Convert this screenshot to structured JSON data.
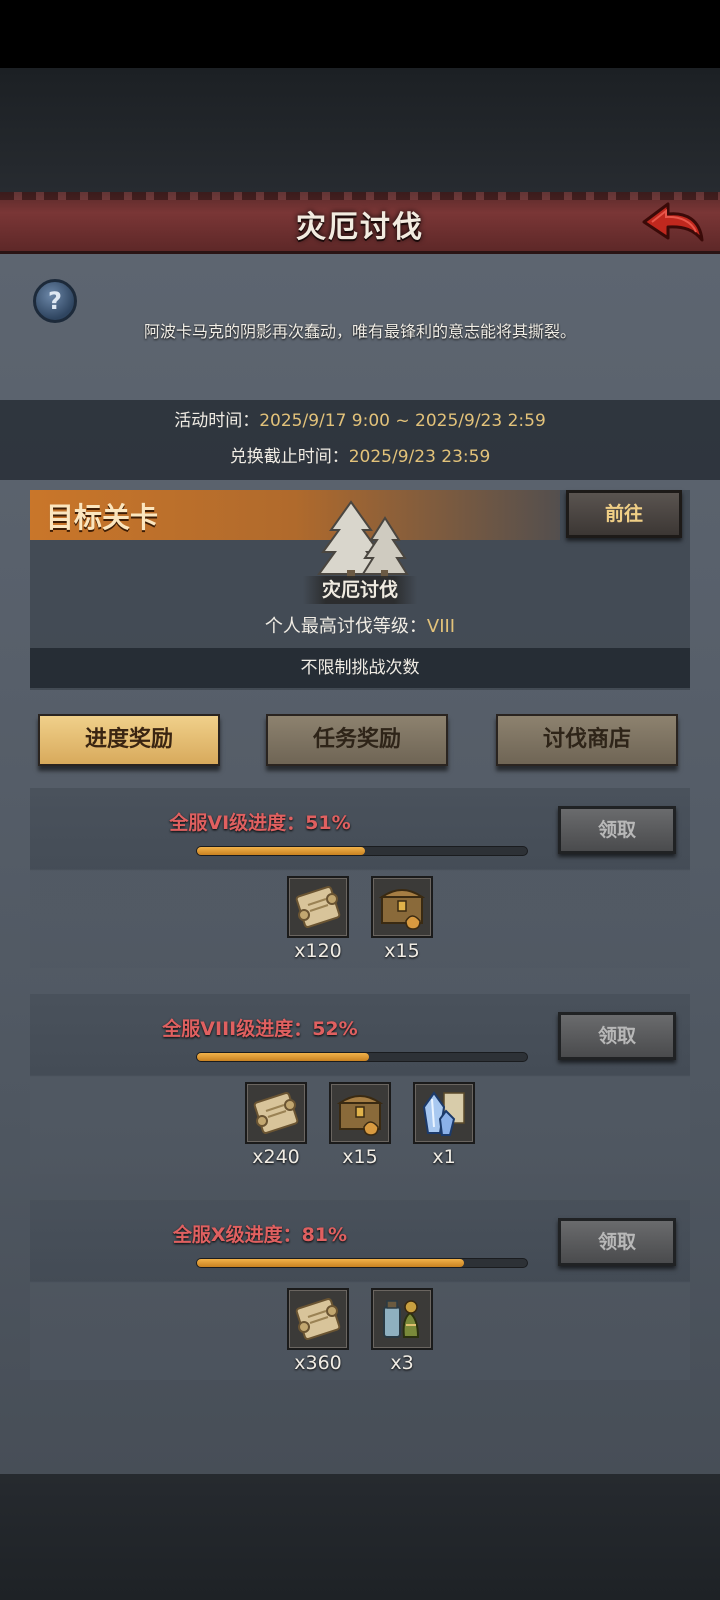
{
  "header": {
    "title": "灾厄讨伐"
  },
  "description": "阿波卡马克的阴影再次蠢动，唯有最锋利的意志能将其撕裂。",
  "event_time": {
    "label": "活动时间：",
    "value": "2025/9/17 9:00 ~ 2025/9/23 2:59"
  },
  "exchange_deadline": {
    "label": "兑换截止时间：",
    "value": "2025/9/23 23:59"
  },
  "target": {
    "title": "目标关卡",
    "goto_label": "前往",
    "stage_name": "灾厄讨伐",
    "best_level_label": "个人最高讨伐等级：",
    "best_level_value": "VIII",
    "unlimited_text": "不限制挑战次数"
  },
  "tabs": [
    {
      "label": "进度奖励",
      "active": true
    },
    {
      "label": "任务奖励",
      "active": false
    },
    {
      "label": "讨伐商店",
      "active": false
    }
  ],
  "rewards": [
    {
      "label": "全服VI级进度：51%",
      "progress": 0.51,
      "claim_label": "领取",
      "items": [
        {
          "icon": "scroll-icon",
          "qty": "x120"
        },
        {
          "icon": "treasure-chest-icon",
          "qty": "x15"
        }
      ]
    },
    {
      "label": "全服VIII级进度：52%",
      "progress": 0.52,
      "claim_label": "领取",
      "items": [
        {
          "icon": "scroll-icon",
          "qty": "x240"
        },
        {
          "icon": "treasure-chest-icon",
          "qty": "x15"
        },
        {
          "icon": "crystal-icon",
          "qty": "x1"
        }
      ]
    },
    {
      "label": "全服X级进度：81%",
      "progress": 0.81,
      "claim_label": "领取",
      "items": [
        {
          "icon": "scroll-icon",
          "qty": "x360"
        },
        {
          "icon": "potion-icon",
          "qty": "x3"
        }
      ]
    }
  ],
  "colors": {
    "accent_gold": "#e2c27a",
    "progress_red": "#e06060",
    "tab_active": "#f0d08a",
    "title_bar": "#7a3636"
  }
}
